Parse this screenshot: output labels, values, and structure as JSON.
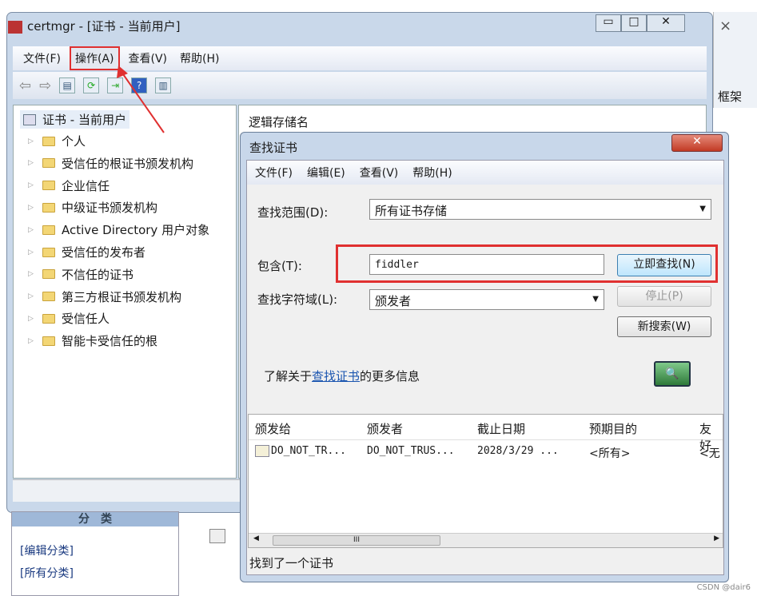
{
  "main_window": {
    "title": "certmgr - [证书 - 当前用户]",
    "menu": [
      "文件(F)",
      "操作(A)",
      "查看(V)",
      "帮助(H)"
    ],
    "tree": {
      "root": "证书 - 当前用户",
      "items": [
        "个人",
        "受信任的根证书颁发机构",
        "企业信任",
        "中级证书颁发机构",
        "Active Directory 用户对象",
        "受信任的发布者",
        "不信任的证书",
        "第三方根证书颁发机构",
        "受信任人",
        "智能卡受信任的根"
      ]
    },
    "right_header": "逻辑存储名"
  },
  "background": {
    "right_label": "框架",
    "close": "×",
    "category_header": "分　类",
    "category_items": [
      "[编辑分类]",
      "[所有分类]"
    ]
  },
  "dialog": {
    "title": "查找证书",
    "menu": [
      "文件(F)",
      "编辑(E)",
      "查看(V)",
      "帮助(H)"
    ],
    "scope_label": "查找范围(D):",
    "scope_value": "所有证书存储",
    "contains_label": "包含(T):",
    "contains_value": "fiddler",
    "field_label": "查找字符域(L):",
    "field_value": "颁发者",
    "find_now": "立即查找(N)",
    "stop": "停止(P)",
    "new_search": "新搜索(W)",
    "info_prefix": "了解关于",
    "info_link": "查找证书",
    "info_suffix": "的更多信息",
    "columns": [
      "颁发给",
      "颁发者",
      "截止日期",
      "预期目的",
      "友好"
    ],
    "rows": [
      [
        "DO_NOT_TR...",
        "DO_NOT_TRUS...",
        "2028/3/29 ...",
        "<所有>",
        "<无"
      ]
    ],
    "status": "找到了一个证书"
  },
  "watermark": "CSDN @dair6",
  "colors": {
    "highlight": "#e03030",
    "link": "#1a55b0"
  }
}
